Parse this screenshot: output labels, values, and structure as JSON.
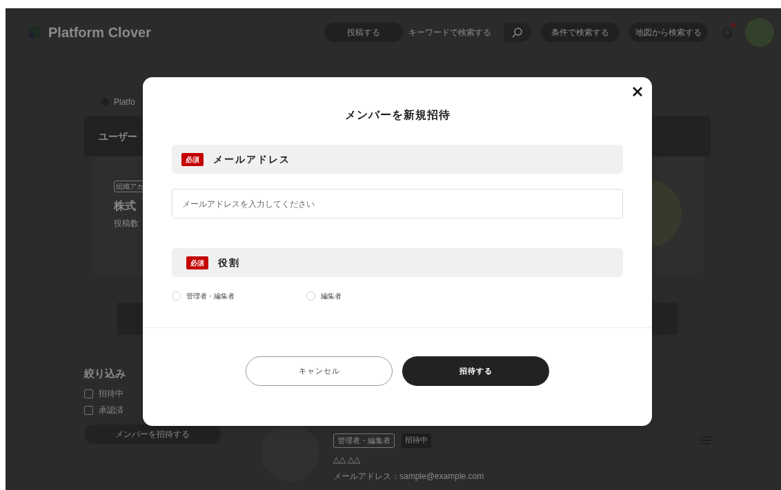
{
  "header": {
    "logo": "Platform Clover",
    "post_button": "投稿する",
    "search": {
      "placeholder": "キーワードで検索する"
    },
    "nav_buttons": [
      "条件で検索する",
      "地図から検索する"
    ]
  },
  "breadcrumb": "Platfo",
  "page_header": {
    "title": "ユーザー"
  },
  "profile": {
    "tag": "組織アカ",
    "name": "株式",
    "posts": "投稿数"
  },
  "filter": {
    "title": "絞り込み",
    "options": [
      {
        "label": "招待中",
        "checked": false
      },
      {
        "label": "承認済",
        "checked": false
      }
    ],
    "invite_button": "メンバーを招待する"
  },
  "member": {
    "tags": [
      {
        "label": "管理者・編集者",
        "kind": "outline"
      },
      {
        "label": "招待中",
        "kind": "filled"
      }
    ],
    "name": "△△ △△",
    "email": "メールアドレス：sample@example.com"
  },
  "modal": {
    "title": "メンバーを新規招待",
    "fields": [
      {
        "kind": "text",
        "required_badge": "必須",
        "label": "メールアドレス",
        "placeholder": "メールアドレスを入力してください"
      },
      {
        "kind": "radio",
        "required_badge": "必須",
        "label": "役割",
        "options": [
          {
            "label": "管理者・編集者",
            "selected": false
          },
          {
            "label": "編集者",
            "selected": false
          }
        ]
      }
    ],
    "buttons": [
      {
        "kind": "secondary",
        "label": "キャンセル"
      },
      {
        "kind": "primary",
        "label": "招待する"
      }
    ]
  }
}
